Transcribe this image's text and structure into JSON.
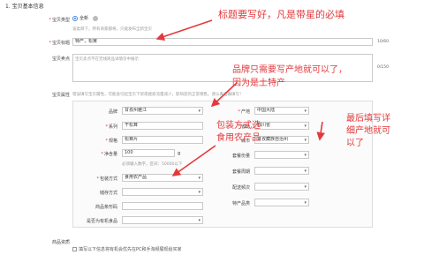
{
  "section": {
    "title": "1. 宝贝基本信息"
  },
  "type_row": {
    "label": "宝贝类型",
    "radio_label": "全新",
    "hint": "该类目下，所有商家都将，只能发布全新宝贝"
  },
  "title_row": {
    "label": "宝贝标题",
    "value": "特产，松茸",
    "counter": "10/60"
  },
  "selling_point_row": {
    "label": "宝贝卖点",
    "placeholder": "宝贝卖点不在无线商品详情页中展示",
    "counter": "0/150"
  },
  "attr_section": {
    "label": "宝贝属性",
    "hint": "错误填写宝贝属性，可能会引起宝贝下架或搜索流量减少，影响您的正常销售，请认真准确填写！"
  },
  "left_attrs": [
    {
      "label": "品牌",
      "value": "甘孜州雅江",
      "type": "select"
    },
    {
      "label": "系列",
      "value": "干松茸",
      "type": "input",
      "required": true
    },
    {
      "label": "规格",
      "value": "松茸片",
      "type": "input",
      "required": true
    },
    {
      "label": "净含量",
      "value": "100",
      "unit": "g",
      "type": "input",
      "required": true
    },
    {
      "label": "包装方式",
      "value": "食用农产品",
      "type": "select",
      "required": true
    },
    {
      "label": "储存方式",
      "value": "",
      "type": "select"
    },
    {
      "label": "商品条形码",
      "value": "",
      "type": "input"
    },
    {
      "label": "是否为有机食品",
      "value": "",
      "type": "select"
    }
  ],
  "net_hint": "必须输入数字，区间：50000以下",
  "right_attrs": [
    {
      "label": "产地",
      "value": "中国大陆",
      "type": "select",
      "required": true
    },
    {
      "label": "省份",
      "value": "四川省",
      "type": "select",
      "required": true
    },
    {
      "label": "城市",
      "value": "甘孜藏族自治州",
      "type": "select"
    },
    {
      "label": "套餐份量",
      "value": "",
      "type": "select"
    },
    {
      "label": "套餐周期",
      "value": "",
      "type": "select"
    },
    {
      "label": "配送频次",
      "value": "",
      "type": "select"
    },
    {
      "label": "特产品类",
      "value": "",
      "type": "select"
    }
  ],
  "qualification": {
    "label": "商品资质",
    "checkbox_label": "填写以下信息将有机会优先在PC和手淘频展现给买家"
  },
  "annotations": {
    "title_note": "标题要写好，凡是带星的必填",
    "brand_note_1": "品牌只需要写产地就可以了，",
    "brand_note_2": "因为是土特产",
    "pack_note_1": "包装方式选",
    "pack_note_2": "食用农产品",
    "origin_note_1": "最后填写详",
    "origin_note_2": "细产地就可",
    "origin_note_3": "以了",
    "color": "#e4393c"
  }
}
